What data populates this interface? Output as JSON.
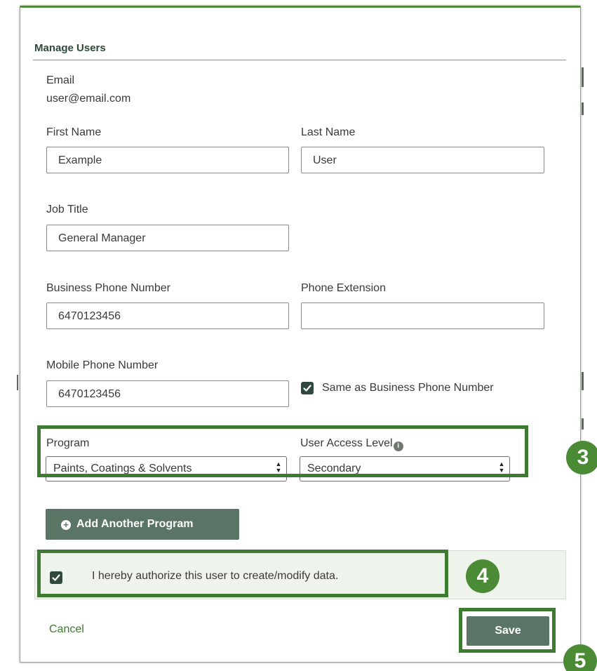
{
  "modal": {
    "title": "Manage Users"
  },
  "email": {
    "label": "Email",
    "value": "user@email.com"
  },
  "first_name": {
    "label": "First Name",
    "value": "Example"
  },
  "last_name": {
    "label": "Last Name",
    "value": "User"
  },
  "job_title": {
    "label": "Job Title",
    "value": "General Manager"
  },
  "business_phone": {
    "label": "Business Phone Number",
    "value": "6470123456"
  },
  "phone_extension": {
    "label": "Phone Extension",
    "value": ""
  },
  "mobile_phone": {
    "label": "Mobile Phone Number",
    "value": "6470123456"
  },
  "same_as_business": {
    "label": "Same as Business Phone Number",
    "checked": true
  },
  "program": {
    "label": "Program",
    "selected": "Paints, Coatings & Solvents"
  },
  "user_access_level": {
    "label": "User Access Level",
    "selected": "Secondary",
    "info_icon": "info-icon"
  },
  "add_program_button": {
    "label": "Add Another Program",
    "icon": "plus-circle-icon"
  },
  "authorize": {
    "label": "I hereby authorize this user to create/modify data.",
    "checked": true
  },
  "footer": {
    "cancel_label": "Cancel",
    "save_label": "Save"
  },
  "tutorial_steps": {
    "step3": "3",
    "step4": "4",
    "step5": "5"
  },
  "colors": {
    "accent_green": "#3f7a33",
    "button_green": "#5a7466",
    "checkbox_dark": "#2f4a3d",
    "panel_bg": "#eef3ec"
  }
}
